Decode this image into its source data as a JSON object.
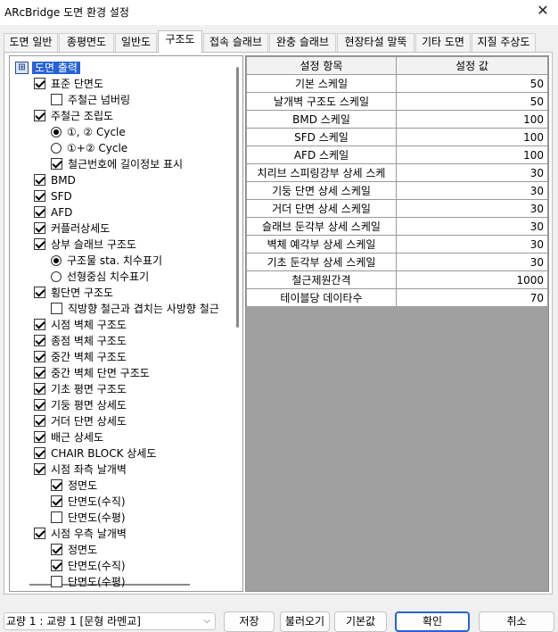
{
  "window": {
    "title": "ARcBridge 도면 환경 설정",
    "close_glyph": "✕"
  },
  "tabs": [
    "도면 일반",
    "종평면도",
    "일반도",
    "구조도",
    "접속 슬래브",
    "완충 슬래브",
    "현장타설 말뚝",
    "기타 도면",
    "지질 주상도"
  ],
  "active_tab": "구조도",
  "tree": {
    "root": {
      "label": "도면 출력",
      "icon": "tree-root-icon"
    },
    "items": [
      {
        "label": "표준 단면도",
        "control": "checkbox",
        "checked": true,
        "level": 1
      },
      {
        "label": "주철근 넘버링",
        "control": "checkbox",
        "checked": false,
        "level": 2
      },
      {
        "label": "주철근 조립도",
        "control": "checkbox",
        "checked": true,
        "level": 1
      },
      {
        "label": "①, ② Cycle",
        "control": "radio",
        "checked": true,
        "level": 2
      },
      {
        "label": "①+② Cycle",
        "control": "radio",
        "checked": false,
        "level": 2
      },
      {
        "label": "철근번호에 길이정보 표시",
        "control": "checkbox",
        "checked": true,
        "level": 2
      },
      {
        "label": "BMD",
        "control": "checkbox",
        "checked": true,
        "level": 1
      },
      {
        "label": "SFD",
        "control": "checkbox",
        "checked": true,
        "level": 1
      },
      {
        "label": "AFD",
        "control": "checkbox",
        "checked": true,
        "level": 1
      },
      {
        "label": "커플러상세도",
        "control": "checkbox",
        "checked": true,
        "level": 1
      },
      {
        "label": "상부 슬래브 구조도",
        "control": "checkbox",
        "checked": true,
        "level": 1
      },
      {
        "label": "구조물 sta. 치수표기",
        "control": "radio",
        "checked": true,
        "level": 2
      },
      {
        "label": "선형중심 치수표기",
        "control": "radio",
        "checked": false,
        "level": 2
      },
      {
        "label": "횡단면 구조도",
        "control": "checkbox",
        "checked": true,
        "level": 1
      },
      {
        "label": "직방향 철근과 겹치는 사방향 철근",
        "control": "checkbox",
        "checked": false,
        "level": 2
      },
      {
        "label": "시점 벽체 구조도",
        "control": "checkbox",
        "checked": true,
        "level": 1
      },
      {
        "label": "종점 벽체 구조도",
        "control": "checkbox",
        "checked": true,
        "level": 1
      },
      {
        "label": "중간 벽체 구조도",
        "control": "checkbox",
        "checked": true,
        "level": 1
      },
      {
        "label": "중간 벽체 단면 구조도",
        "control": "checkbox",
        "checked": true,
        "level": 1
      },
      {
        "label": "기초 평면 구조도",
        "control": "checkbox",
        "checked": true,
        "level": 1
      },
      {
        "label": "기둥 평면 상세도",
        "control": "checkbox",
        "checked": true,
        "level": 1
      },
      {
        "label": "거더 단면 상세도",
        "control": "checkbox",
        "checked": true,
        "level": 1
      },
      {
        "label": "배근 상세도",
        "control": "checkbox",
        "checked": true,
        "level": 1
      },
      {
        "label": "CHAIR BLOCK 상세도",
        "control": "checkbox",
        "checked": true,
        "level": 1
      },
      {
        "label": "시점 좌측 날개벽",
        "control": "checkbox",
        "checked": true,
        "level": 1
      },
      {
        "label": "정면도",
        "control": "checkbox",
        "checked": true,
        "level": 2
      },
      {
        "label": "단면도(수직)",
        "control": "checkbox",
        "checked": true,
        "level": 2
      },
      {
        "label": "단면도(수평)",
        "control": "checkbox",
        "checked": false,
        "level": 2
      },
      {
        "label": "시점 우측 날개벽",
        "control": "checkbox",
        "checked": true,
        "level": 1
      },
      {
        "label": "정면도",
        "control": "checkbox",
        "checked": true,
        "level": 2
      },
      {
        "label": "단면도(수직)",
        "control": "checkbox",
        "checked": true,
        "level": 2
      },
      {
        "label": "단면도(수평)",
        "control": "checkbox",
        "checked": false,
        "level": 2
      }
    ]
  },
  "grid": {
    "headers": [
      "설정 항목",
      "설정 값"
    ],
    "rows": [
      [
        "기본 스케일",
        "50"
      ],
      [
        "날개벽 구조도 스케일",
        "50"
      ],
      [
        "BMD 스케일",
        "100"
      ],
      [
        "SFD 스케일",
        "100"
      ],
      [
        "AFD 스케일",
        "100"
      ],
      [
        "치리브 스피링강부 상세 스케",
        "30"
      ],
      [
        "기둥 단면 상세 스케일",
        "30"
      ],
      [
        "거더 단면 상세 스케일",
        "30"
      ],
      [
        "슬래브 둔각부 상세 스케일",
        "30"
      ],
      [
        "벽체 예각부 상세 스케일",
        "30"
      ],
      [
        "기초 둔각부 상세 스케일",
        "30"
      ],
      [
        "철근제원간격",
        "1000"
      ],
      [
        "테이블당 데이타수",
        "70"
      ]
    ]
  },
  "footer": {
    "bridge_select": "교량 1 : 교량 1 [문형 라멘교]",
    "save_label": "저장",
    "load_label": "불러오기",
    "default_label": "기본값",
    "ok_label": "확인",
    "cancel_label": "취소"
  }
}
